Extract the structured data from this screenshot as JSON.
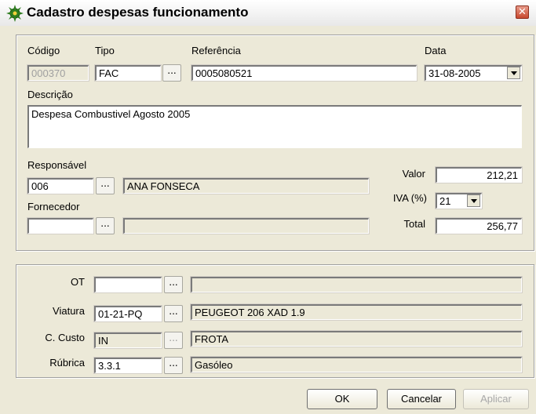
{
  "window": {
    "title": "Cadastro despesas funcionamento",
    "close_glyph": "✕"
  },
  "labels": {
    "codigo": "Código",
    "tipo": "Tipo",
    "referencia": "Referência",
    "data": "Data",
    "descricao": "Descrição",
    "responsavel": "Responsável",
    "fornecedor": "Fornecedor",
    "valor": "Valor",
    "iva": "IVA (%)",
    "total": "Total",
    "ot": "OT",
    "viatura": "Viatura",
    "c_custo": "C. Custo",
    "rubrica": "Rúbrica"
  },
  "fields": {
    "codigo": "000370",
    "tipo": "FAC",
    "referencia": "0005080521",
    "data": "31-08-2005",
    "descricao": "Despesa Combustivel Agosto 2005",
    "responsavel_code": "006",
    "responsavel_name": "ANA FONSECA",
    "fornecedor_code": "",
    "fornecedor_name": "",
    "valor": "212,21",
    "iva": "21",
    "total": "256,77",
    "ot_code": "",
    "ot_name": "",
    "viatura_code": "01-21-PQ",
    "viatura_name": "PEUGEOT 206 XAD 1.9",
    "c_custo_code": "IN",
    "c_custo_name": "FROTA",
    "rubrica_code": "3.3.1",
    "rubrica_name": "Gasóleo"
  },
  "browse_label": "...",
  "buttons": {
    "ok": "OK",
    "cancelar": "Cancelar",
    "aplicar": "Aplicar"
  }
}
